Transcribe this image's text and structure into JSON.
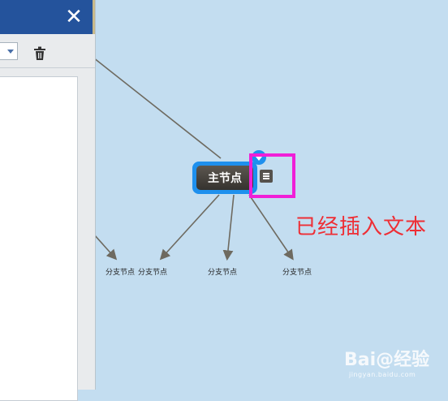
{
  "panel": {
    "close_glyph": "✕",
    "icons": {
      "close": "close-icon",
      "dropdown": "chevron-down-icon",
      "delete": "trash-icon"
    }
  },
  "mindmap": {
    "main_node": {
      "label": "主节点"
    },
    "branches": [
      {
        "label": "分支节点"
      },
      {
        "label": "分支节点"
      },
      {
        "label": "分支节点"
      },
      {
        "label": "分支节点"
      }
    ],
    "note_icon": "note-icon"
  },
  "annotation": {
    "text": "已经插入文本"
  },
  "watermark": {
    "logo": "Bai@经验",
    "url": "jingyan.baidu.com"
  },
  "colors": {
    "canvas_bg": "#c3ddf0",
    "header_blue": "#24539c",
    "node_selected": "#1e90ee",
    "highlight_magenta": "#f01fd7",
    "annotation_red": "#ee2e35"
  }
}
